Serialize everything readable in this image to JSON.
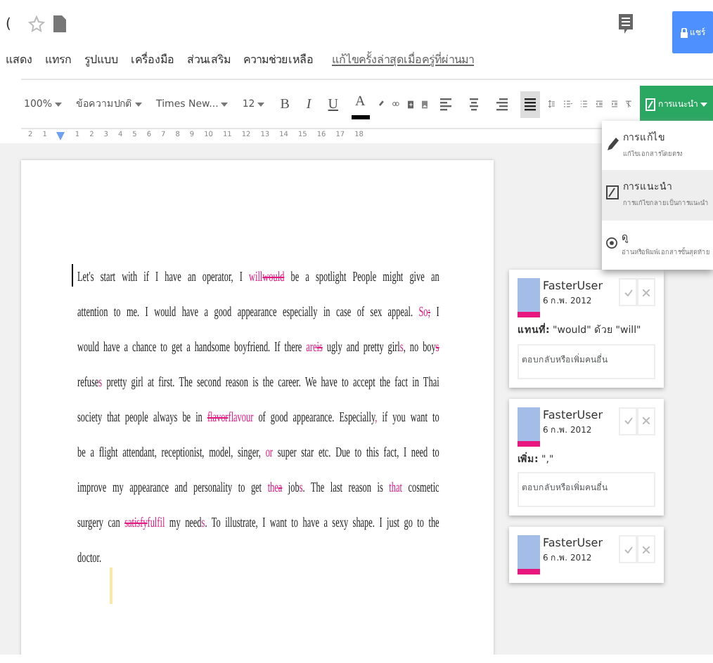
{
  "title_bar": {
    "title_fragment": "(",
    "share_button": "แชร์"
  },
  "menu": [
    "แสดง",
    "แทรก",
    "รูปแบบ",
    "เครื่องมือ",
    "ส่วนเสริม",
    "ความช่วยเหลือ"
  ],
  "last_edit_link": "แก้ไขครั้งล่าสุดเมื่อครู่ที่ผ่านมา",
  "toolbar": {
    "zoom": "100%",
    "style": "ข้อความปกติ",
    "font": "Times New...",
    "size": "12",
    "format_buttons": [
      "B",
      "I",
      "U",
      "A"
    ],
    "align_buttons": [
      {
        "kind": "left",
        "selected": false
      },
      {
        "kind": "center",
        "selected": false
      },
      {
        "kind": "right",
        "selected": false
      },
      {
        "kind": "justify",
        "selected": true
      }
    ],
    "mode_button": "การแนะนำ"
  },
  "ruler": [
    "2",
    "1",
    "1",
    "2",
    "3",
    "4",
    "5",
    "6",
    "7",
    "8",
    "9",
    "10",
    "11",
    "12",
    "13",
    "14",
    "15",
    "16",
    "17",
    "18"
  ],
  "mode_menu": [
    {
      "kind": "edit",
      "title": "การแก้ไข",
      "description": "แก้ไขเอกสารโดยตรง",
      "selected": false
    },
    {
      "kind": "suggest",
      "title": "การแนะนำ",
      "description": "การแก้ไขกลายเป็นการแนะนำ",
      "selected": true
    },
    {
      "kind": "view",
      "title": "ดู",
      "description": "อ่านหรือพิมพ์เอกสารขั้นสุดท้าย",
      "selected": false
    }
  ],
  "document": {
    "lines": [
      [
        {
          "kind": "normal",
          "text": "Let's start with if I have an operator, I "
        },
        {
          "kind": "insert",
          "text": "will"
        },
        {
          "kind": "delete",
          "text": "would"
        },
        {
          "kind": "normal",
          "text": " be a spotlight People might give an"
        }
      ],
      [
        {
          "kind": "normal",
          "text": "attention to me. I would have a good appearance especially in case of sex appeal. "
        },
        {
          "kind": "insert",
          "text": "So"
        },
        {
          "kind": "delete",
          "text": ";"
        },
        {
          "kind": "normal",
          "text": " I"
        }
      ],
      [
        {
          "kind": "normal",
          "text": "would have a chance to get a handsome boyfriend. If there "
        },
        {
          "kind": "insert",
          "text": "are"
        },
        {
          "kind": "delete",
          "text": "is"
        },
        {
          "kind": "normal",
          "text": " ugly and pretty girl"
        },
        {
          "kind": "insert",
          "text": "s"
        },
        {
          "kind": "normal",
          "text": ", no boy"
        },
        {
          "kind": "delete",
          "text": "s"
        }
      ],
      [
        {
          "kind": "normal",
          "text": "refuse"
        },
        {
          "kind": "insert",
          "text": "s"
        },
        {
          "kind": "normal",
          "text": " pretty girl at first. The second reason is the career. We have to accept the fact in Thai"
        }
      ],
      [
        {
          "kind": "normal",
          "text": "society that people always be in "
        },
        {
          "kind": "delete",
          "text": "flavor"
        },
        {
          "kind": "insert",
          "text": "flavour"
        },
        {
          "kind": "normal",
          "text": " of good appearance. Especially"
        },
        {
          "kind": "insert",
          "text": ","
        },
        {
          "kind": "normal",
          "text": " if you want to"
        }
      ],
      [
        {
          "kind": "normal",
          "text": "be a flight attendant, receptionist, model, singer, "
        },
        {
          "kind": "insert",
          "text": "or"
        },
        {
          "kind": "normal",
          "text": " super star etc. Due to this fact, I need to"
        }
      ],
      [
        {
          "kind": "normal",
          "text": "improve my appearance and personality to get "
        },
        {
          "kind": "insert",
          "text": "the"
        },
        {
          "kind": "delete",
          "text": "a"
        },
        {
          "kind": "normal",
          "text": " job"
        },
        {
          "kind": "insert",
          "text": "s"
        },
        {
          "kind": "normal",
          "text": ". The last reason is "
        },
        {
          "kind": "insert",
          "text": "that"
        },
        {
          "kind": "normal",
          "text": " cosmetic"
        }
      ],
      [
        {
          "kind": "normal",
          "text": "surgery can "
        },
        {
          "kind": "delete",
          "text": "satisfy"
        },
        {
          "kind": "insert",
          "text": "fulfil"
        },
        {
          "kind": "normal",
          "text": " my need"
        },
        {
          "kind": "insert",
          "text": "s"
        },
        {
          "kind": "normal",
          "text": ". To illustrate, I want to have a sexy shape. I just go to the"
        }
      ],
      [
        {
          "kind": "normal",
          "text": "doctor."
        }
      ]
    ]
  },
  "comments": [
    {
      "author": "FasterUser",
      "date": "6 ก.พ. 2012",
      "change": "**แทนที่:** \"would\" ด้วย \"will\"",
      "reply_placeholder": "ตอบกลับหรือเพิ่มคนอื่น"
    },
    {
      "author": "FasterUser",
      "date": "6 ก.พ. 2012",
      "change": "**เพิ่ม:** \",\"",
      "reply_placeholder": "ตอบกลับหรือเพิ่มคนอื่น"
    },
    {
      "author": "FasterUser",
      "date": "6 ก.พ. 2012"
    }
  ]
}
